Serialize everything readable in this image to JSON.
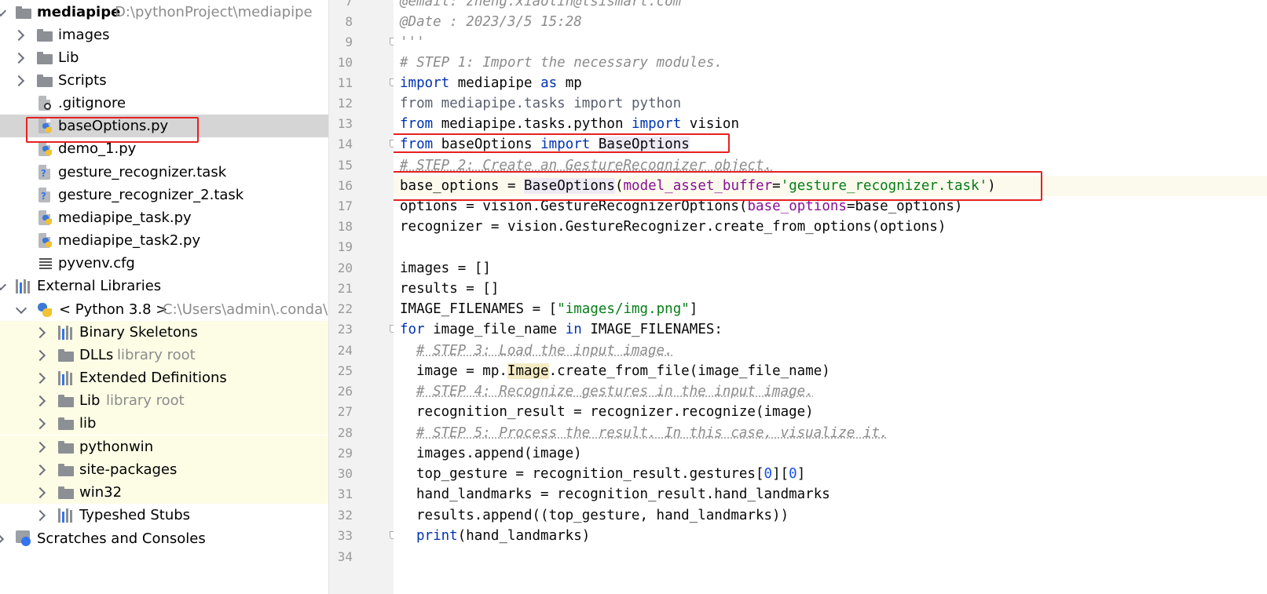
{
  "project_tree": {
    "root": {
      "name": "mediapipe",
      "path": "D:\\pythonProject\\mediapipe"
    },
    "items": [
      {
        "label": "images",
        "type": "folder"
      },
      {
        "label": "Lib",
        "type": "folder"
      },
      {
        "label": "Scripts",
        "type": "folder"
      },
      {
        "label": ".gitignore",
        "type": "ignore-file"
      },
      {
        "label": "baseOptions.py",
        "type": "python-file"
      },
      {
        "label": "demo_1.py",
        "type": "python-file"
      },
      {
        "label": "gesture_recognizer.task",
        "type": "unknown-file"
      },
      {
        "label": "gesture_recognizer_2.task",
        "type": "unknown-file"
      },
      {
        "label": "mediapipe_task.py",
        "type": "python-file"
      },
      {
        "label": "mediapipe_task2.py",
        "type": "python-file"
      },
      {
        "label": "pyvenv.cfg",
        "type": "config-file"
      }
    ],
    "external_libraries": "External Libraries",
    "python_sdk": {
      "name": "< Python 3.8 >",
      "path": "C:\\Users\\admin\\.conda\\en"
    },
    "sdk_items": [
      {
        "label": "Binary Skeletons",
        "hint": "",
        "type": "library"
      },
      {
        "label": "DLLs",
        "hint": "library root",
        "type": "folder"
      },
      {
        "label": "Extended Definitions",
        "hint": "",
        "type": "library"
      },
      {
        "label": "Lib",
        "hint": "library root",
        "type": "folder"
      },
      {
        "label": "lib",
        "hint": "",
        "type": "folder"
      },
      {
        "label": "pythonwin",
        "hint": "",
        "type": "folder"
      },
      {
        "label": "site-packages",
        "hint": "",
        "type": "folder"
      },
      {
        "label": "win32",
        "hint": "",
        "type": "folder"
      }
    ],
    "typeshed": "Typeshed Stubs",
    "scratches": "Scratches and Consoles"
  },
  "editor": {
    "line_numbers": [
      "7",
      "8",
      "9",
      "10",
      "11",
      "12",
      "13",
      "14",
      "15",
      "16",
      "17",
      "18",
      "19",
      "20",
      "21",
      "22",
      "23",
      "24",
      "25",
      "26",
      "27",
      "28",
      "29",
      "30",
      "31",
      "32",
      "33",
      "34"
    ],
    "lines": {
      "l7": "@email: zheng.xiaolin@tsismart.com",
      "l8": "@Date : 2023/3/5 15:28",
      "l9": "'''",
      "l10": "# STEP 1: Import the necessary modules.",
      "l11": {
        "k1": "import",
        "t1": " mediapipe ",
        "k2": "as",
        "t2": " mp"
      },
      "l12": "from mediapipe.tasks import python",
      "l13": {
        "k1": "from",
        "t1": " mediapipe.tasks.python ",
        "k2": "import",
        "t2": " vision"
      },
      "l14": {
        "k1": "from",
        "t1": " baseOptions ",
        "k2": "import",
        "t2": " ",
        "id": "BaseOptions"
      },
      "l15": "# STEP 2: Create an GestureRecognizer object.",
      "l16": {
        "t1": "base_options = ",
        "id": "BaseOptions",
        "t2": "(",
        "p": "model_asset_buffer",
        "t3": "=",
        "s": "'gesture_recognizer.task'",
        "t4": ")"
      },
      "l17": {
        "t1": "options = vision.GestureRecognizerOptions(",
        "p": "base_options",
        "t2": "=base_options)"
      },
      "l18": "recognizer = vision.GestureRecognizer.create_from_options(options)",
      "l20": "images = []",
      "l21": "results = []",
      "l22": {
        "t1": "IMAGE_FILENAMES = [",
        "s": "\"images/img.png\"",
        "t2": "]"
      },
      "l23": {
        "k1": "for",
        "t1": " image_file_name ",
        "k2": "in",
        "t2": " IMAGE_FILENAMES:"
      },
      "l24": "# STEP 3: Load the input image.",
      "l25": {
        "t1": "image = mp.",
        "id": "Image",
        "t2": ".create_from_file(image_file_name)"
      },
      "l26": "# STEP 4: Recognize gestures in the input image.",
      "l27": "recognition_result = recognizer.recognize(image)",
      "l28": "# STEP 5: Process the result. In this case, visualize it.",
      "l29": "images.append(image)",
      "l30": {
        "t1": "top_gesture = recognition_result.gestures[",
        "n1": "0",
        "t2": "][",
        "n2": "0",
        "t3": "]"
      },
      "l31": "hand_landmarks = recognition_result.hand_landmarks",
      "l32": "results.append((top_gesture, hand_landmarks))",
      "l33": {
        "k1": "print",
        "t1": "(hand_landmarks)"
      }
    }
  },
  "colors": {
    "annotation_red": "#e62020",
    "keyword_blue": "#0033b3",
    "string_green": "#067d17",
    "param_purple": "#871094",
    "comment_gray": "#8c8c8c",
    "selection_gray": "#d5d5d5",
    "library_yellow": "#fdfde6"
  }
}
